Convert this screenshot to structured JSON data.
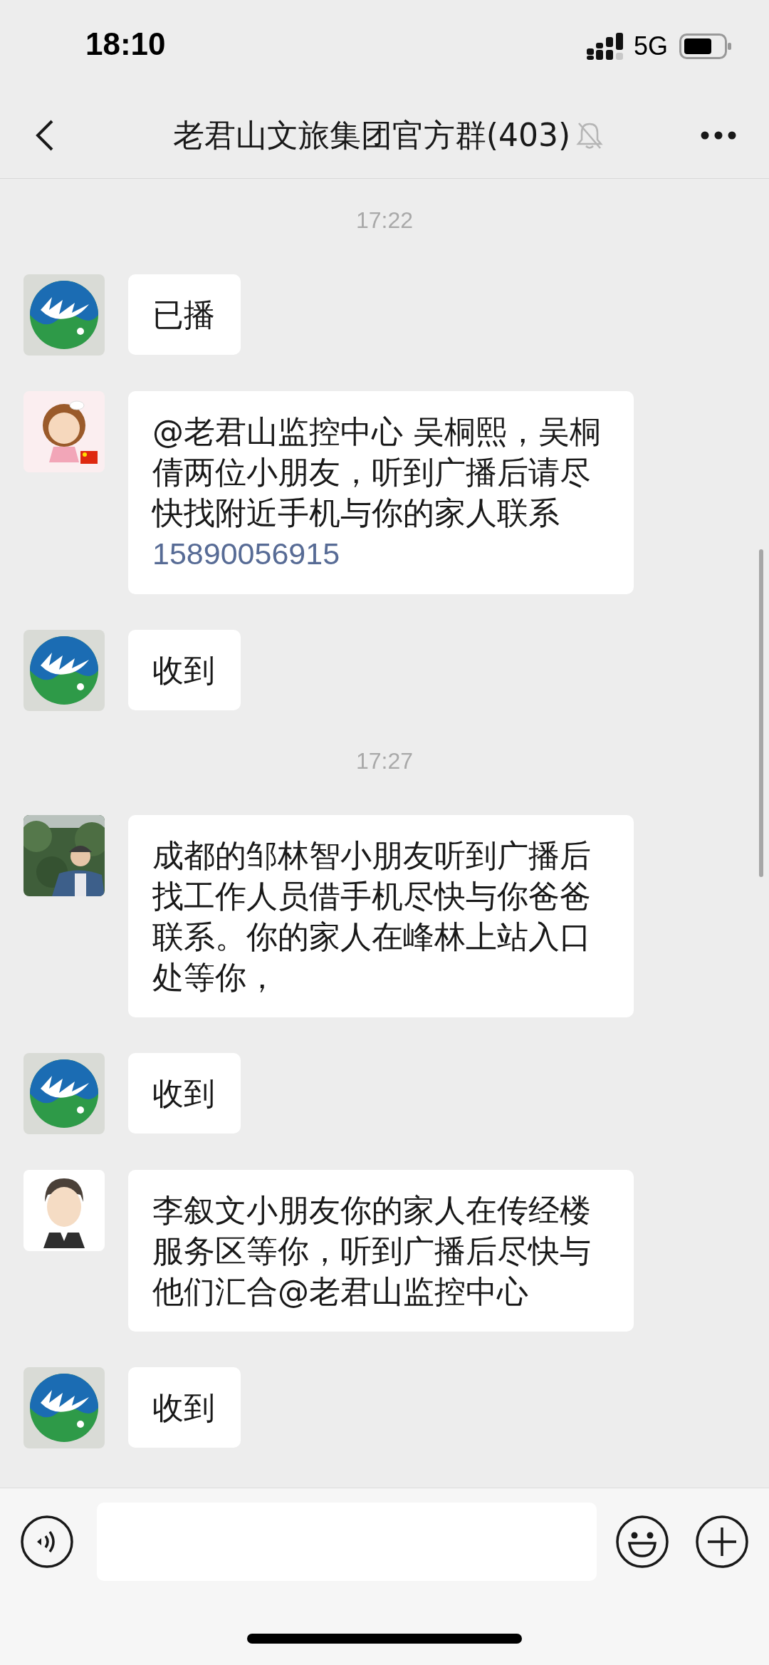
{
  "status_bar": {
    "time": "18:10",
    "network": "5G"
  },
  "header": {
    "title": "老君山文旅集团官方群(403)",
    "muted": true
  },
  "messages": [
    {
      "kind": "time",
      "text": "17:22"
    },
    {
      "kind": "message",
      "avatar": {
        "kind": "logo"
      },
      "text": "已播"
    },
    {
      "kind": "message",
      "avatar": {
        "kind": "girl"
      },
      "text": "@老君山监控中心 吴桐熙，吴桐倩两位小朋友，听到广播后请尽快找附近手机与你的家人联系",
      "link": "15890056915"
    },
    {
      "kind": "message",
      "avatar": {
        "kind": "logo"
      },
      "text": "收到"
    },
    {
      "kind": "time",
      "text": "17:27"
    },
    {
      "kind": "message",
      "text": "成都的邹林智小朋友听到广播后找工作人员借手机尽快与你爸爸联系。你的家人在峰林上站入口处等你，"
    },
    {
      "kind": "message",
      "avatar": {
        "kind": "logo"
      },
      "text": "收到"
    },
    {
      "kind": "message",
      "avatar": {
        "kind": "boy"
      },
      "text": "李叙文小朋友你的家人在传经楼服务区等你，听到广播后尽快与他们汇合@老君山监控中心"
    },
    {
      "kind": "message",
      "avatar": {
        "kind": "logo"
      },
      "text": "收到"
    }
  ]
}
